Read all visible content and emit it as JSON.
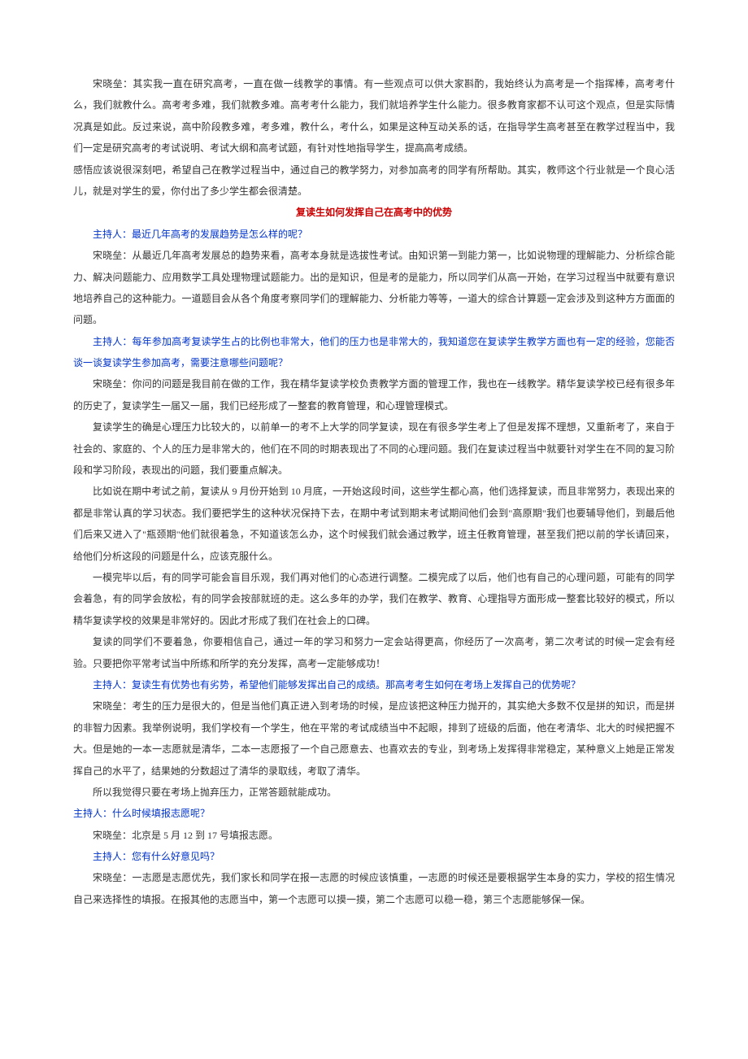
{
  "p1": "宋晓垒：其实我一直在研究高考，一直在做一线教学的事情。有一些观点可以供大家斟酌，我始终认为高考是一个指挥棒，高考考什么，我们就教什么。高考考多难，我们就教多难。高考考什么能力，我们就培养学生什么能力。很多教育家都不认可这个观点，但是实际情况真是如此。反过来说，高中阶段教多难，考多难，教什么，考什么，如果是这种互动关系的话，在指导学生高考甚至在教学过程当中，我们一定是研究高考的考试说明、考试大纲和高考试题，有针对性地指导学生，提高高考成绩。",
  "p2": "感悟应该说很深刻吧，希望自己在教学过程当中，通过自己的教学努力，对参加高考的同学有所帮助。其实，教师这个行业就是一个良心活儿，就是对学生的爱，你付出了多少学生都会很清楚。",
  "sectionTitle": "复读生如何发挥自己在高考中的优势",
  "h1": "主持人：最近几年高考的发展趋势是怎么样的呢？",
  "p3": "宋晓垒：从最近几年高考发展总的趋势来看，高考本身就是选拔性考试。由知识第一到能力第一，比如说物理的理解能力、分析综合能力、解决问题能力、应用数学工具处理物理试题能力。出的是知识，但是考的是能力，所以同学们从高一开始，在学习过程当中就要有意识地培养自己的这种能力。一道题目会从各个角度考察同学们的理解能力、分析能力等等，一道大的综合计算题一定会涉及到这种方方面面的问题。",
  "h2": "主持人：每年参加高考复读学生占的比例也非常大，他们的压力也是非常大的，我知道您在复读学生教学方面也有一定的经验，您能否谈一谈复读学生参加高考，需要注意哪些问题呢？",
  "p4": "宋晓垒：你问的问题是我目前在做的工作，我在精华复读学校负责教学方面的管理工作，我也在一线教学。精华复读学校已经有很多年的历史了，复读学生一届又一届，我们已经形成了一整套的教育管理，和心理管理模式。",
  "p5": "复读学生的确是心理压力比较大的，以前单一的考不上大学的同学复读，现在有很多学生考上了但是发挥不理想，又重新考了，来自于社会的、家庭的、个人的压力是非常大的，他们在不同的时期表现出了不同的心理问题。我们在复读过程当中就要针对学生在不同的复习阶段和学习阶段，表现出的问题，我们要重点解决。",
  "p6": "比如说在期中考试之前，复读从 9 月份开始到 10 月底，一开始这段时间，这些学生都心高，他们选择复读，而且非常努力，表现出来的都是非常认真的学习状态。我们要把学生的这种状况保持下去，在期中考试到期末考试期间他们会到\"高原期\"我们也要辅导他们，到最后他们后来又进入了\"瓶颈期\"他们就很着急，不知道该怎么办，这个时候我们就会通过教学，班主任教育管理，甚至我们把以前的学长请回来，给他们分析这段的问题是什么，应该克服什么。",
  "p7": "一模完毕以后，有的同学可能会盲目乐观，我们再对他们的心态进行调整。二模完成了以后，他们也有自己的心理问题，可能有的同学会着急，有的同学会放松，有的同学会按部就班的走。这么多年的办学，我们在教学、教育、心理指导方面形成一整套比较好的模式，所以精华复读学校的效果是非常好的。因此才形成了我们在社会上的口碑。",
  "p8": "复读的同学们不要着急，你要相信自己，通过一年的学习和努力一定会站得更高，你经历了一次高考，第二次考试的时候一定会有经验。只要把你平常考试当中所练和所学的充分发挥，高考一定能够成功！",
  "h3": "主持人：复读生有优势也有劣势，希望他们能够发挥出自己的成绩。那高考考生如何在考场上发挥自己的优势呢？",
  "p9": "宋晓垒：考生的压力是很大的，但是当他们真正进入到考场的时候，是应该把这种压力抛开的，其实绝大多数不仅是拼的知识，而是拼的非智力因素。我举例说明，我们学校有一个学生，他在平常的考试成绩当中不起眼，排到了班级的后面，他在考清华、北大的时候把握不大。但是她的一本一志愿就是清华，二本一志愿报了一个自己愿意去、也喜欢去的专业，到考场上发挥得非常稳定，某种意义上她是正常发挥自己的水平了，结果她的分数超过了清华的录取线，考取了清华。",
  "p10": "所以我觉得只要在考场上抛弃压力，正常答题就能成功。",
  "h4": "主持人：什么时候填报志愿呢？",
  "p11": "宋晓垒：北京是 5 月 12 到 17 号填报志愿。",
  "h5": "主持人：您有什么好意见吗？",
  "p12": "宋晓垒：一志愿是志愿优先，我们家长和同学在报一志愿的时候应该慎重，一志愿的时候还是要根据学生本身的实力，学校的招生情况自己来选择性的填报。在报其他的志愿当中，第一个志愿可以摸一摸，第二个志愿可以稳一稳，第三个志愿能够保一保。"
}
